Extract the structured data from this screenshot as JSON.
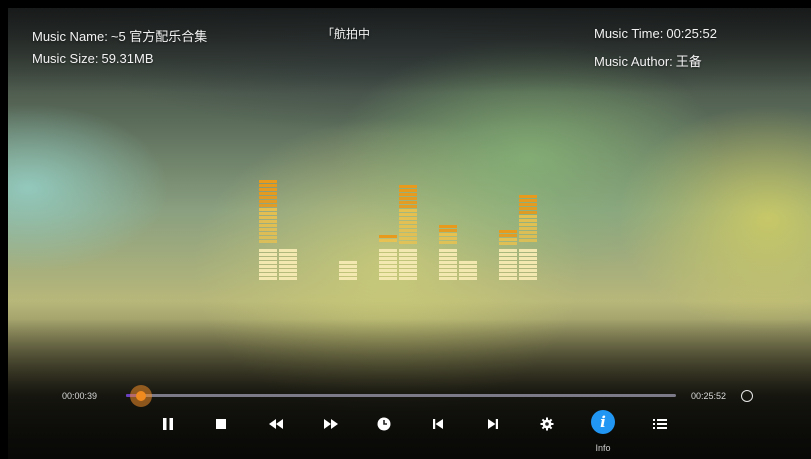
{
  "music": {
    "name_label": "Music Name:",
    "name_value": "~5 官方配乐合集",
    "size_label": "Music Size:",
    "size_value": "59.31MB",
    "time_label": "Music Time:",
    "time_value": "00:25:52",
    "author_label": "Music Author:",
    "author_value": "王备",
    "lyric_snippet": "「航拍中"
  },
  "progress": {
    "current": "00:00:39",
    "total": "00:25:52",
    "fraction": 0.025
  },
  "controls": [
    {
      "name": "pause-button",
      "icon": "pause-icon"
    },
    {
      "name": "stop-button",
      "icon": "stop-icon"
    },
    {
      "name": "rewind-button",
      "icon": "rewind-icon"
    },
    {
      "name": "fast-forward-button",
      "icon": "fast-forward-icon"
    },
    {
      "name": "timer-button",
      "icon": "clock-icon"
    },
    {
      "name": "previous-button",
      "icon": "skip-previous-icon"
    },
    {
      "name": "next-button",
      "icon": "skip-next-icon"
    },
    {
      "name": "settings-button",
      "icon": "gear-icon"
    },
    {
      "name": "info-button",
      "icon": "info-icon",
      "label": "Info"
    },
    {
      "name": "playlist-button",
      "icon": "list-icon"
    }
  ],
  "equalizer": {
    "pale_levels": [
      0.85,
      0.85,
      0.0,
      0.55,
      0.9,
      0.9,
      0.85,
      0.55,
      0.8,
      0.85
    ],
    "peak_levels": [
      1.0,
      0.0,
      0.0,
      0.0,
      0.45,
      0.95,
      0.55,
      0.0,
      0.5,
      0.85
    ]
  },
  "colors": {
    "accent": "#2196f3",
    "progress": "#6b3fc0",
    "thumb": "#f08a1e",
    "eq_pale": "#f3e9b0",
    "eq_mid": "#f0c24a",
    "eq_peak": "#e89a1c"
  }
}
